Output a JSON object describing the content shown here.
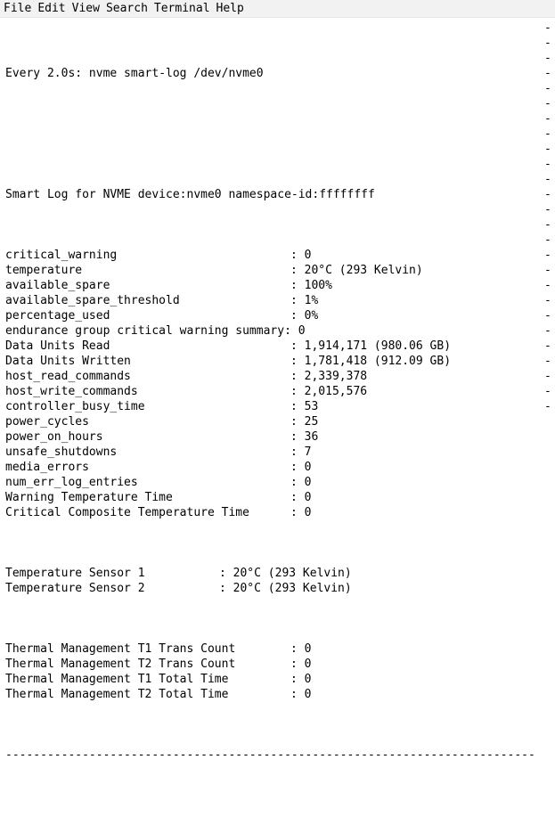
{
  "menubar": {
    "file": "File",
    "edit": "Edit",
    "view": "View",
    "search": "Search",
    "terminal": "Terminal",
    "help": "Help"
  },
  "watch": {
    "prefix": "Every 2.0s: ",
    "command": "nvme smart-log /dev/nvme0"
  },
  "smartlog": {
    "header": "Smart Log for NVME device:nvme0 namespace-id:ffffffff",
    "rows": [
      {
        "label": "critical_warning",
        "value": "0"
      },
      {
        "label": "temperature",
        "value": "20°C (293 Kelvin)"
      },
      {
        "label": "available_spare",
        "value": "100%"
      },
      {
        "label": "available_spare_threshold",
        "value": "1%"
      },
      {
        "label": "percentage_used",
        "value": "0%"
      },
      {
        "label": "endurance group critical warning summary:",
        "value": "0"
      },
      {
        "label": "Data Units Read",
        "value": "1,914,171 (980.06 GB)"
      },
      {
        "label": "Data Units Written",
        "value": "1,781,418 (912.09 GB)"
      },
      {
        "label": "host_read_commands",
        "value": "2,339,378"
      },
      {
        "label": "host_write_commands",
        "value": "2,015,576"
      },
      {
        "label": "controller_busy_time",
        "value": "53"
      },
      {
        "label": "power_cycles",
        "value": "25"
      },
      {
        "label": "power_on_hours",
        "value": "36"
      },
      {
        "label": "unsafe_shutdowns",
        "value": "7"
      },
      {
        "label": "media_errors",
        "value": "0"
      },
      {
        "label": "num_err_log_entries",
        "value": "0"
      },
      {
        "label": "Warning Temperature Time",
        "value": "0"
      },
      {
        "label": "Critical Composite Temperature Time",
        "value": "0"
      }
    ],
    "sensors": [
      {
        "label": "Temperature Sensor 1",
        "value": "20°C (293 Kelvin)"
      },
      {
        "label": "Temperature Sensor 2",
        "value": "20°C (293 Kelvin)"
      }
    ],
    "thermal": [
      {
        "label": "Thermal Management T1 Trans Count",
        "value": "0"
      },
      {
        "label": "Thermal Management T2 Trans Count",
        "value": "0"
      },
      {
        "label": "Thermal Management T1 Total Time",
        "value": "0"
      },
      {
        "label": "Thermal Management T2 Total Time",
        "value": "0"
      }
    ]
  },
  "glyphs": {
    "colon_sep": ": ",
    "vdash": "-",
    "hdash_line": "----------------------------------------------------------------------------"
  }
}
